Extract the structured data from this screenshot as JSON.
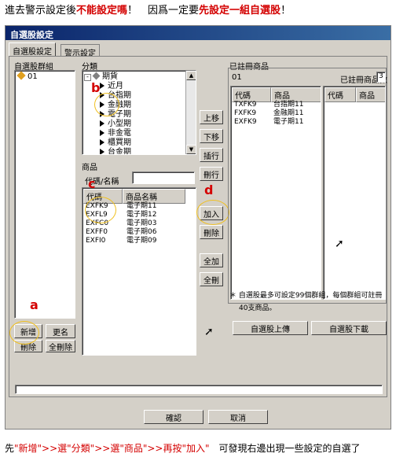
{
  "caption_top": {
    "part1": "進去警示設定後",
    "part2": "不能設定嗎",
    "part3": "！　因爲一定要",
    "part4": "先設定一組自選股",
    "part5": "！"
  },
  "window": {
    "title": "自選股設定",
    "tabs": [
      "自選股設定",
      "警示設定"
    ]
  },
  "groups": {
    "label": "自選股群組",
    "items": [
      "01"
    ],
    "buttons": {
      "add": "新增",
      "rename": "更名",
      "delete": "刪除",
      "delete_all": "全刪除"
    }
  },
  "category": {
    "label": "分類",
    "root": "期貨",
    "items": [
      "近月",
      "台指期",
      "金融期",
      "電子期",
      "小型期",
      "非金電",
      "櫃買期",
      "台金期"
    ]
  },
  "products": {
    "label": "商品",
    "search_label": "代碼/名稱",
    "search_value": "",
    "headers": [
      "代碼",
      "商品名稱"
    ],
    "rows": [
      [
        "EXFK9",
        "電子期11"
      ],
      [
        "EXFL9",
        "電子期12"
      ],
      [
        "EXFC0",
        "電子期03"
      ],
      [
        "EXFF0",
        "電子期06"
      ],
      [
        "EXFI0",
        "電子期09"
      ]
    ]
  },
  "actions": {
    "up": "上移",
    "down": "下移",
    "insert": "插行",
    "delete_row": "刪行",
    "add": "加入",
    "remove": "刪除",
    "add_all": "全加",
    "remove_all": "全刪"
  },
  "registered": {
    "label": "已註冊商品",
    "group": "01",
    "count_label": "已註冊商品數",
    "count_value": "3",
    "headers": [
      "代碼",
      "商品"
    ],
    "rows": [
      [
        "TXFK9",
        "台指期11"
      ],
      [
        "FXFK9",
        "金融期11"
      ],
      [
        "EXFK9",
        "電子期11"
      ]
    ],
    "headers2": [
      "代碼",
      "商品"
    ]
  },
  "note": {
    "line1": "自選股最多可設定99個群組，每個群組可註冊",
    "line2": "40支商品。"
  },
  "upload_button": "自選股上傳",
  "download_button": "自選股下載",
  "ok_button": "確認",
  "cancel_button": "取消",
  "caption_bottom": {
    "p1": "先",
    "p2": "\"新增\">>選\"分類\">>選\"商品\">>再按\"加入\"",
    "p3": "　可發現右邊出現一些設定的自選了"
  },
  "annotations": {
    "mark_b": "b",
    "mark_c": "c",
    "mark_d": "d",
    "mark_a": "a"
  }
}
